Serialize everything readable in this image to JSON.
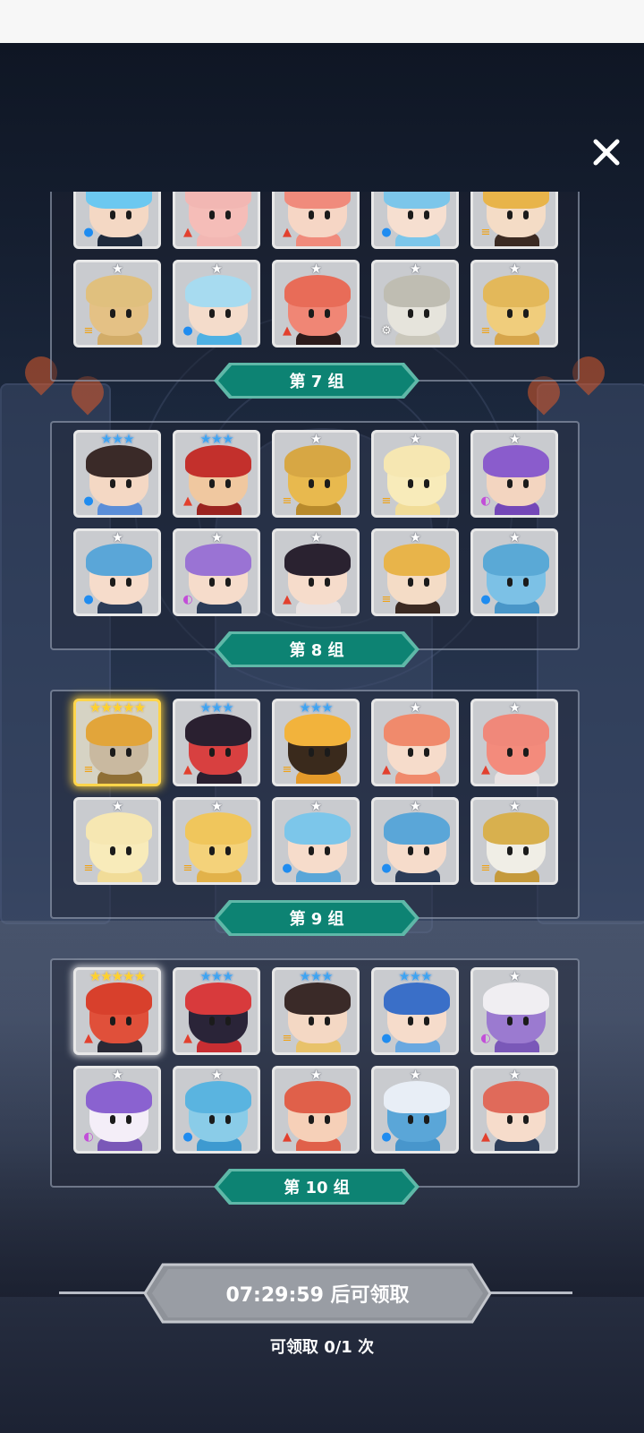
{
  "colors": {
    "banner": "#0d8373",
    "banner_border": "#5fb8a8",
    "button": "#8e9299"
  },
  "close_icon": "close-icon",
  "groups": [
    {
      "label": "第 7 组",
      "slots": [
        {
          "stars": "★★★",
          "star_color": "blue",
          "element": "water",
          "hair": "#6cc8f0",
          "skin": "#f4d8c4",
          "body": "#1f2a3c"
        },
        {
          "stars": "★",
          "star_color": "white",
          "element": "fire",
          "hair": "#f2b7b3",
          "skin": "#f5bdb8",
          "body": "#f2b7b3"
        },
        {
          "stars": "★",
          "star_color": "white",
          "element": "fire",
          "hair": "#f08b7c",
          "skin": "#f6d6c5",
          "body": "#f08b7c"
        },
        {
          "stars": "★",
          "star_color": "white",
          "element": "water",
          "hair": "#7cc6ea",
          "skin": "#f6dfd0",
          "body": "#7cc6ea"
        },
        {
          "stars": "★",
          "star_color": "white",
          "element": "wind",
          "hair": "#e8b44a",
          "skin": "#f4dcc6",
          "body": "#3b2a22"
        },
        {
          "stars": "★",
          "star_color": "white",
          "element": "wind",
          "hair": "#e0c07e",
          "skin": "#e4c185",
          "body": "#d2ac68"
        },
        {
          "stars": "★",
          "star_color": "white",
          "element": "water",
          "hair": "#a7dbf0",
          "skin": "#f4dccb",
          "body": "#4fb1e3"
        },
        {
          "stars": "★",
          "star_color": "white",
          "element": "fire",
          "hair": "#e86c58",
          "skin": "#f08675",
          "body": "#2c1b1b"
        },
        {
          "stars": "★",
          "star_color": "white",
          "element": "light",
          "hair": "#bfbdb2",
          "skin": "#e6e4dc",
          "body": "#cac7bb"
        },
        {
          "stars": "★",
          "star_color": "white",
          "element": "wind",
          "hair": "#e3b85a",
          "skin": "#f0cd7c",
          "body": "#d6a54b"
        }
      ]
    },
    {
      "label": "第 8 组",
      "slots": [
        {
          "stars": "★★★",
          "star_color": "blue",
          "element": "water",
          "hair": "#3a2a28",
          "skin": "#f4d8c4",
          "body": "#5b8ed8"
        },
        {
          "stars": "★★★",
          "star_color": "blue",
          "element": "fire",
          "hair": "#c3302c",
          "skin": "#f0c8a0",
          "body": "#9b2420"
        },
        {
          "stars": "★",
          "star_color": "white",
          "element": "wind",
          "hair": "#d7a744",
          "skin": "#e8b94e",
          "body": "#b88a2c"
        },
        {
          "stars": "★",
          "star_color": "white",
          "element": "wind",
          "hair": "#f6e7b2",
          "skin": "#f8ebba",
          "body": "#f1dc98"
        },
        {
          "stars": "★",
          "star_color": "white",
          "element": "dark",
          "hair": "#8a5ccc",
          "skin": "#f3d5c0",
          "body": "#7448b8"
        },
        {
          "stars": "★",
          "star_color": "white",
          "element": "water",
          "hair": "#5aa6d8",
          "skin": "#f6dccb",
          "body": "#2c3c58"
        },
        {
          "stars": "★",
          "star_color": "white",
          "element": "dark",
          "hair": "#9a73d4",
          "skin": "#f6dccb",
          "body": "#2c3c58"
        },
        {
          "stars": "★",
          "star_color": "white",
          "element": "fire",
          "hair": "#2a2230",
          "skin": "#f6dccb",
          "body": "#e8e2e2"
        },
        {
          "stars": "★",
          "star_color": "white",
          "element": "wind",
          "hair": "#e8b44a",
          "skin": "#f4dcc6",
          "body": "#3b2a22"
        },
        {
          "stars": "★",
          "star_color": "white",
          "element": "water",
          "hair": "#5aa9d6",
          "skin": "#7cc1e6",
          "body": "#4996c8"
        }
      ]
    },
    {
      "label": "第 9 组",
      "slots": [
        {
          "stars": "★★★★★",
          "star_color": "gold",
          "element": "wind",
          "hair": "#e2a53a",
          "skin": "#c9b9a0",
          "body": "#8f6f36",
          "highlight": "gold"
        },
        {
          "stars": "★★★",
          "star_color": "blue",
          "element": "fire",
          "hair": "#2a2030",
          "skin": "#d84040",
          "body": "#2a2030"
        },
        {
          "stars": "★★★",
          "star_color": "blue",
          "element": "wind",
          "hair": "#f2b33c",
          "skin": "#3a2a1c",
          "body": "#e49a2a"
        },
        {
          "stars": "★",
          "star_color": "white",
          "element": "fire",
          "hair": "#f08a6c",
          "skin": "#f6dccb",
          "body": "#f08a6c"
        },
        {
          "stars": "★",
          "star_color": "white",
          "element": "fire",
          "hair": "#f0887a",
          "skin": "#f38b7c",
          "body": "#e8e2e2"
        },
        {
          "stars": "★",
          "star_color": "white",
          "element": "wind",
          "hair": "#f6e7b2",
          "skin": "#f8ebba",
          "body": "#f1dc98"
        },
        {
          "stars": "★",
          "star_color": "white",
          "element": "wind",
          "hair": "#f0c65c",
          "skin": "#f4d27a",
          "body": "#e2b24a"
        },
        {
          "stars": "★",
          "star_color": "white",
          "element": "water",
          "hair": "#7cc6ea",
          "skin": "#f6dccb",
          "body": "#5aa6d8"
        },
        {
          "stars": "★",
          "star_color": "white",
          "element": "water",
          "hair": "#5aa6d8",
          "skin": "#f6dccb",
          "body": "#2c3c58"
        },
        {
          "stars": "★",
          "star_color": "white",
          "element": "wind",
          "hair": "#d8b04e",
          "skin": "#f0eee6",
          "body": "#c59a3c"
        }
      ]
    },
    {
      "label": "第 10 组",
      "slots": [
        {
          "stars": "★★★★★",
          "star_color": "gold",
          "element": "fire",
          "hair": "#d8402c",
          "skin": "#e0503a",
          "body": "#2a2a36",
          "highlight": "white"
        },
        {
          "stars": "★★★",
          "star_color": "blue",
          "element": "fire",
          "hair": "#d83a3c",
          "skin": "#2a2438",
          "body": "#c82e32"
        },
        {
          "stars": "★★★",
          "star_color": "blue",
          "element": "wind",
          "hair": "#3a2a28",
          "skin": "#f4d8c4",
          "body": "#e8c26a"
        },
        {
          "stars": "★★★",
          "star_color": "blue",
          "element": "water",
          "hair": "#3a6fc8",
          "skin": "#f6dccb",
          "body": "#6aa8e0"
        },
        {
          "stars": "★",
          "star_color": "white",
          "element": "dark",
          "hair": "#f0eef2",
          "skin": "#9b7ad0",
          "body": "#7a58b8"
        },
        {
          "stars": "★",
          "star_color": "white",
          "element": "dark",
          "hair": "#8a62d0",
          "skin": "#f4eef8",
          "body": "#7a58b8"
        },
        {
          "stars": "★",
          "star_color": "white",
          "element": "water",
          "hair": "#5ab4e0",
          "skin": "#8acce8",
          "body": "#3e9ad0"
        },
        {
          "stars": "★",
          "star_color": "white",
          "element": "fire",
          "hair": "#e0604a",
          "skin": "#f6d0b8",
          "body": "#e0604a"
        },
        {
          "stars": "★",
          "star_color": "white",
          "element": "water",
          "hair": "#e8eef6",
          "skin": "#5aa6d8",
          "body": "#4896cc"
        },
        {
          "stars": "★",
          "star_color": "white",
          "element": "fire",
          "hair": "#e06a5a",
          "skin": "#f6dccb",
          "body": "#2c3c58"
        }
      ]
    }
  ],
  "claim": {
    "button_label": "07:29:59 后可领取",
    "count_text": "可领取 0/1 次"
  }
}
